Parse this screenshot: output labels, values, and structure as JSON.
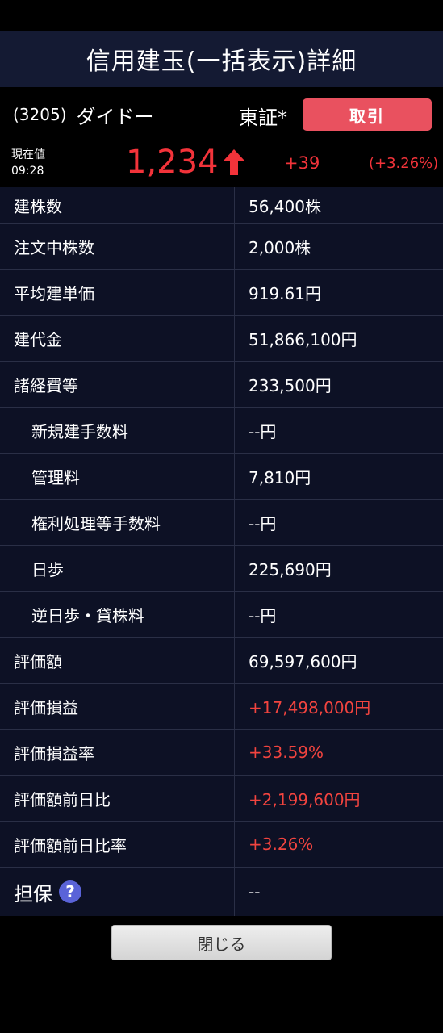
{
  "header": {
    "title": "信用建玉(一括表示)詳細"
  },
  "stock": {
    "code": "(3205)",
    "name": "ダイドー",
    "market": "東証*",
    "trade_button": "取引"
  },
  "price": {
    "label": "現在値",
    "time": "09:28",
    "value": "1,234",
    "change": "+39",
    "change_pct": "(+3.26%)",
    "up_color": "#f2333a"
  },
  "rows": [
    {
      "label": "建株数",
      "value": "56,400株",
      "indent": false,
      "positive": false
    },
    {
      "label": "注文中株数",
      "value": "2,000株",
      "indent": false,
      "positive": false
    },
    {
      "label": "平均建単価",
      "value": "919.61円",
      "indent": false,
      "positive": false
    },
    {
      "label": "建代金",
      "value": "51,866,100円",
      "indent": false,
      "positive": false
    },
    {
      "label": "諸経費等",
      "value": "233,500円",
      "indent": false,
      "positive": false
    },
    {
      "label": "新規建手数料",
      "value": "--円",
      "indent": true,
      "positive": false
    },
    {
      "label": "管理料",
      "value": "7,810円",
      "indent": true,
      "positive": false
    },
    {
      "label": "権利処理等手数料",
      "value": "--円",
      "indent": true,
      "positive": false
    },
    {
      "label": "日歩",
      "value": "225,690円",
      "indent": true,
      "positive": false
    },
    {
      "label": "逆日歩・貸株料",
      "value": "--円",
      "indent": true,
      "positive": false
    },
    {
      "label": "評価額",
      "value": "69,597,600円",
      "indent": false,
      "positive": false
    },
    {
      "label": "評価損益",
      "value": "+17,498,000円",
      "indent": false,
      "positive": true
    },
    {
      "label": "評価損益率",
      "value": "+33.59%",
      "indent": false,
      "positive": true
    },
    {
      "label": "評価額前日比",
      "value": "+2,199,600円",
      "indent": false,
      "positive": true
    },
    {
      "label": "評価額前日比率",
      "value": "+3.26%",
      "indent": false,
      "positive": true
    }
  ],
  "collateral": {
    "label": "担保",
    "help_icon": "question-circle-icon",
    "value": "--"
  },
  "footer": {
    "close_button": "閉じる"
  }
}
